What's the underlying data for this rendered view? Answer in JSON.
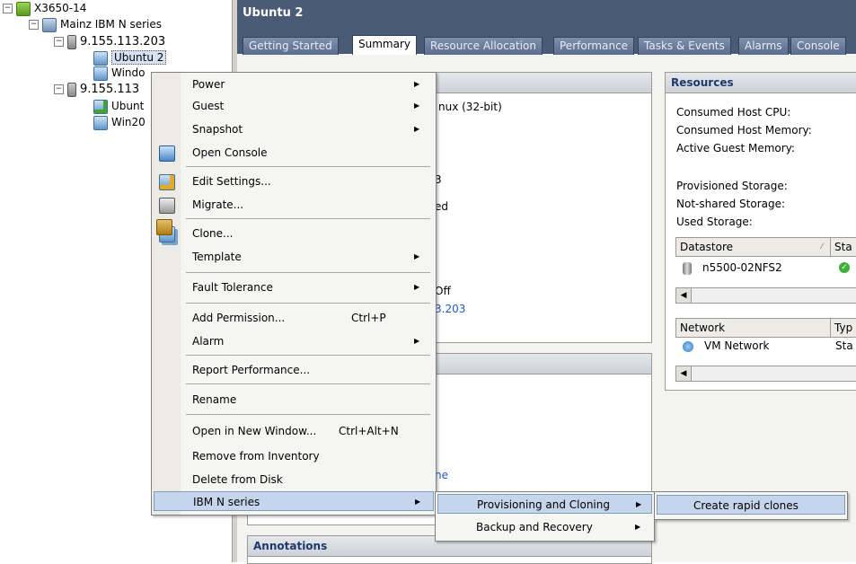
{
  "tree": {
    "root": "X3650-14",
    "cluster": "Mainz IBM N series",
    "host1": "9.155.113.203",
    "vm_selected": "Ubuntu 2",
    "vm_win1": "Windo",
    "host2": "9.155.113",
    "vm_ubuntu": "Ubunt",
    "vm_win2": "Win20"
  },
  "header": {
    "title": "Ubuntu 2"
  },
  "tabs": [
    "Getting Started",
    "Summary",
    "Resource Allocation",
    "Performance",
    "Tasks & Events",
    "Alarms",
    "Console"
  ],
  "general": {
    "os": "nux (32-bit)",
    "v3": "3",
    "ed": "ed",
    "off": "Off",
    "ip": "3.203",
    "ne": "ne"
  },
  "annotations": {
    "title": "Annotations"
  },
  "resources": {
    "title": "Resources",
    "labels": [
      "Consumed Host CPU:",
      "Consumed Host Memory:",
      "Active Guest Memory:",
      "Provisioned Storage:",
      "Not-shared Storage:",
      "Used Storage:"
    ],
    "ds_col1": "Datastore",
    "ds_col2": "Sta",
    "ds_row": "n5500-02NFS2",
    "net_col1": "Network",
    "net_col2": "Typ",
    "net_row": "VM Network",
    "net_type": "Sta"
  },
  "context_menu": {
    "power": "Power",
    "guest": "Guest",
    "snapshot": "Snapshot",
    "open_console": "Open Console",
    "edit_settings": "Edit Settings...",
    "migrate": "Migrate...",
    "clone": "Clone...",
    "template": "Template",
    "fault_tolerance": "Fault Tolerance",
    "add_permission": "Add Permission...",
    "add_permission_shortcut": "Ctrl+P",
    "alarm": "Alarm",
    "report_performance": "Report Performance...",
    "rename": "Rename",
    "open_new_window": "Open in New Window...",
    "open_new_window_shortcut": "Ctrl+Alt+N",
    "remove_inventory": "Remove from Inventory",
    "delete_disk": "Delete from Disk",
    "ibm_n_series": "IBM N series"
  },
  "submenu1": {
    "provisioning": "Provisioning and Cloning",
    "backup": "Backup and Recovery"
  },
  "submenu2": {
    "create_rapid_clones": "Create rapid clones"
  }
}
